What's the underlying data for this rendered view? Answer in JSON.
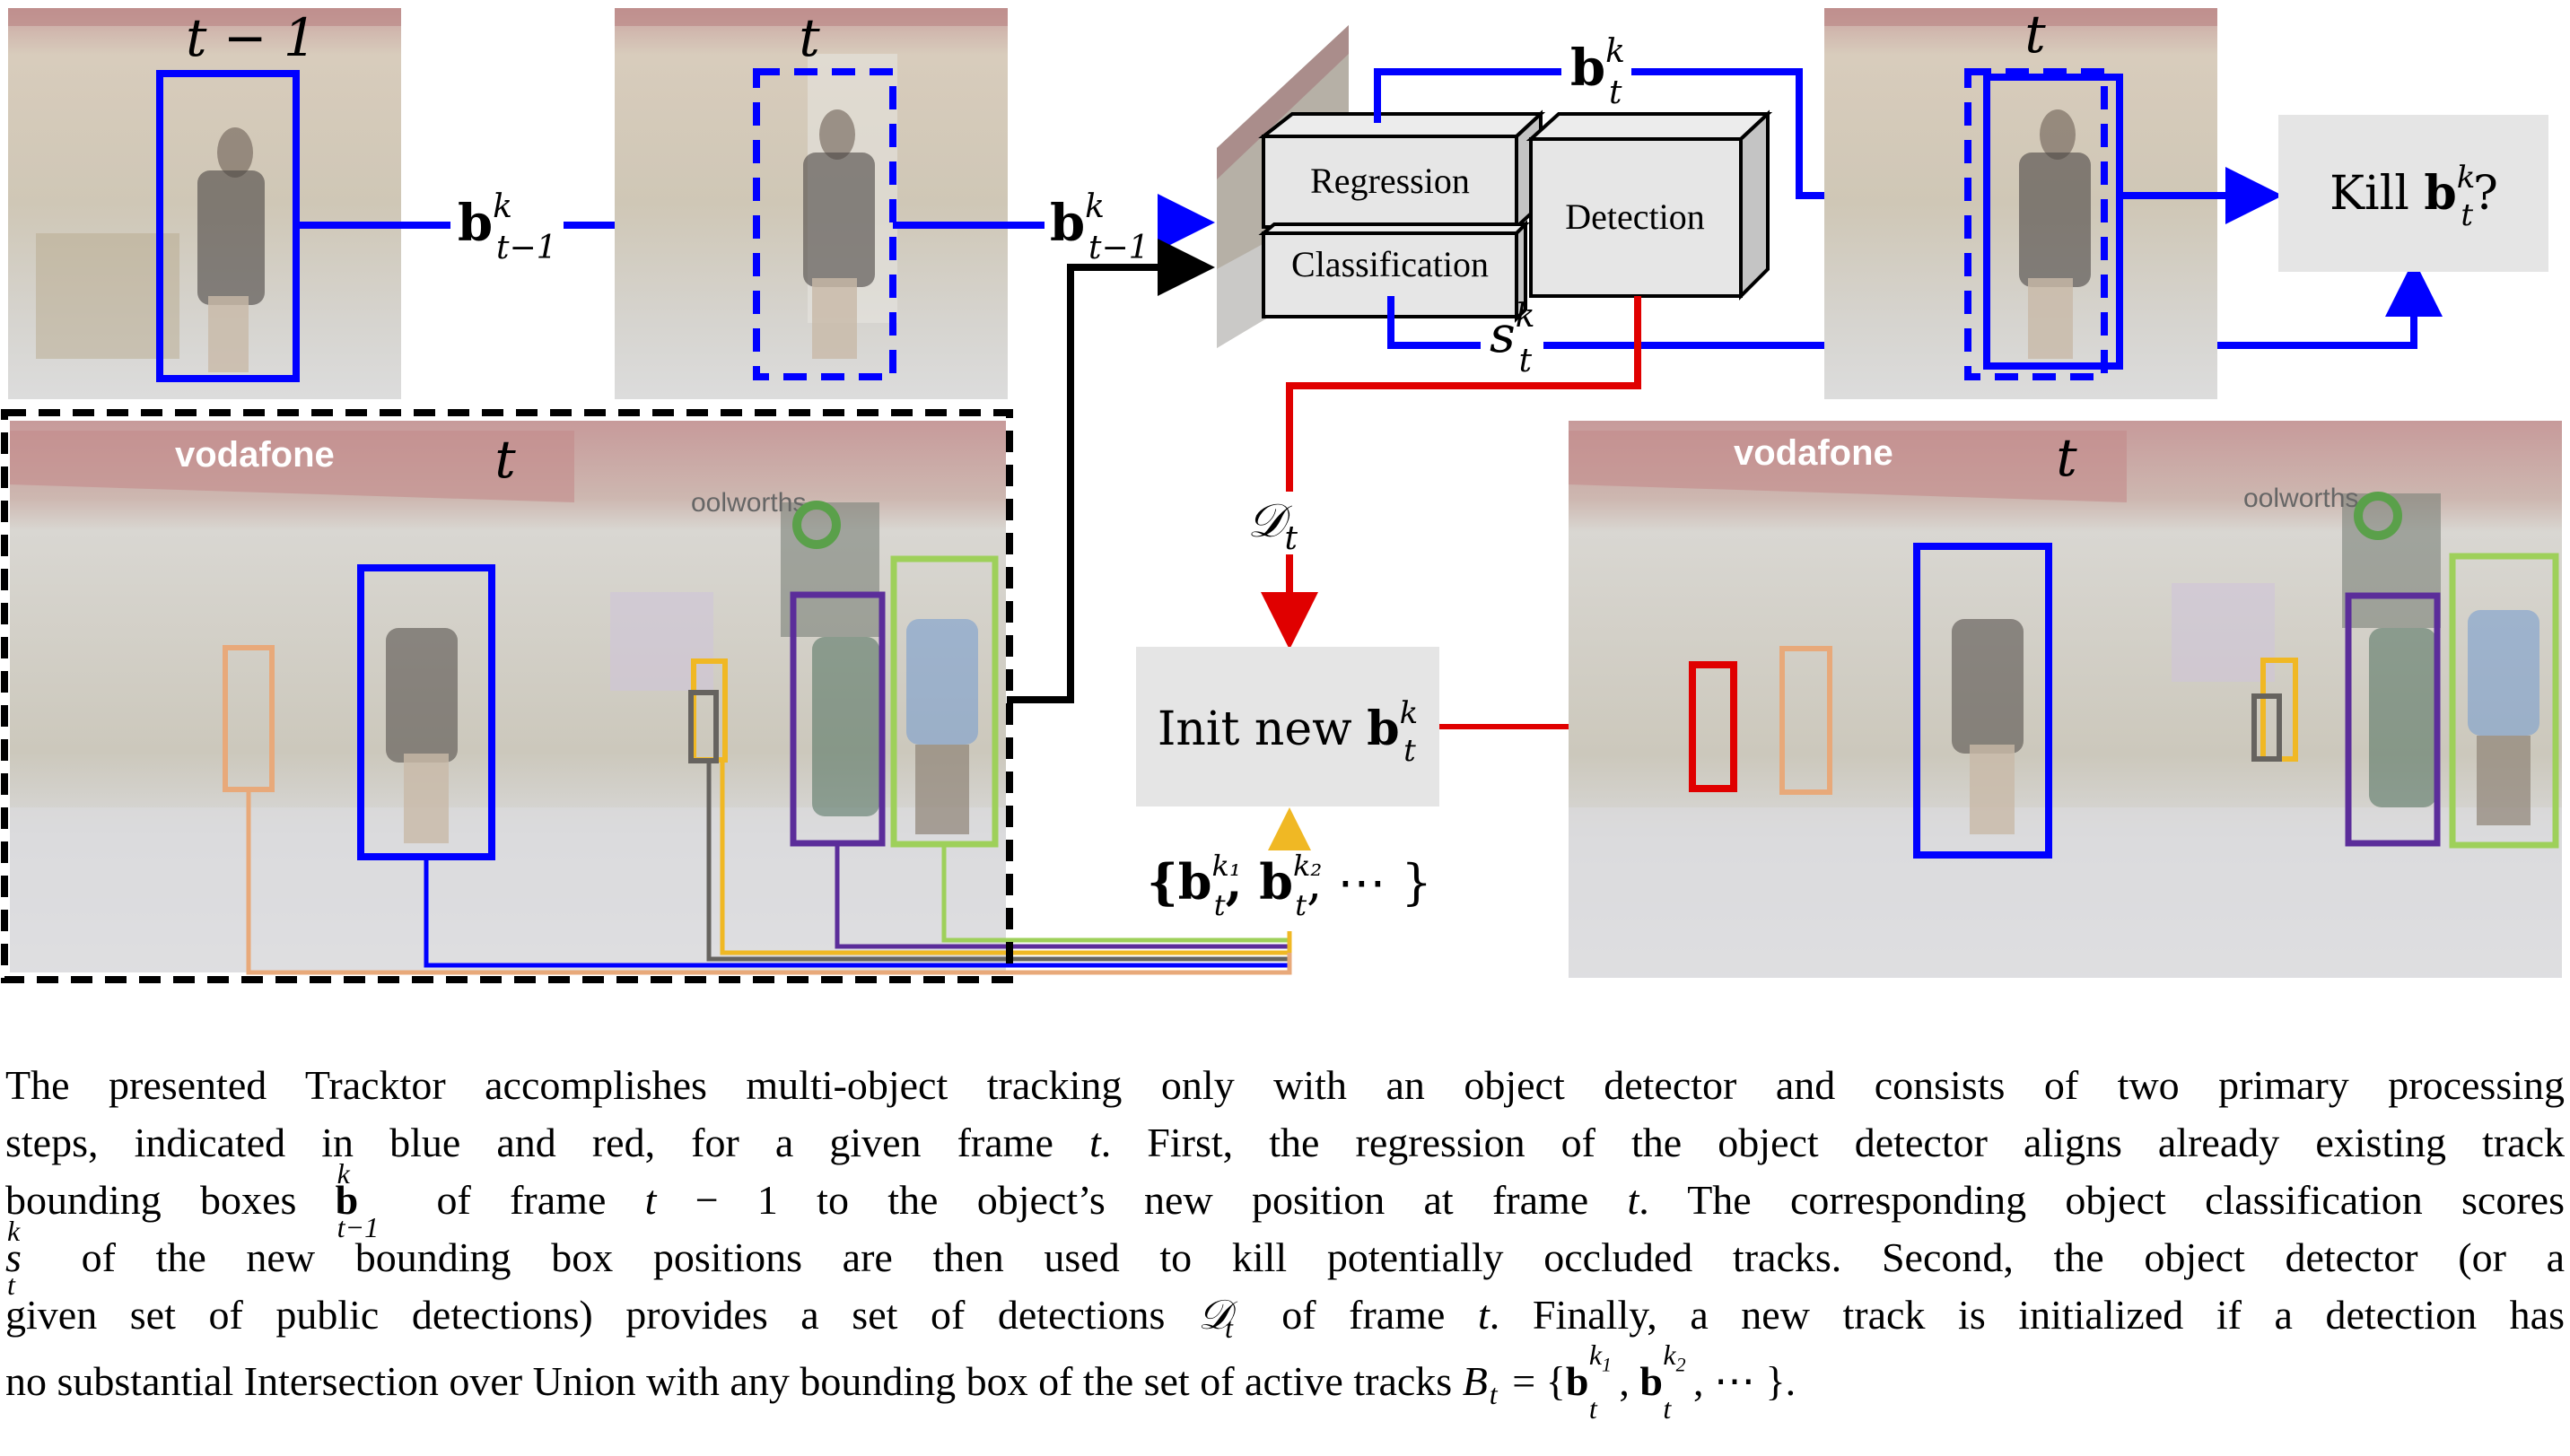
{
  "figure": {
    "frames": {
      "prev_frame_label": "t − 1",
      "curr_frame_label": "t",
      "regressed_frame_label": "t",
      "main_frame_label": "t",
      "output_frame_label": "t",
      "store_sign_left": "vodafone",
      "store_sign_right": "oolworths"
    },
    "edges": {
      "prev_box_label": "b",
      "prev_box_sup": "k",
      "prev_box_sub": "t−1",
      "input_box_label": "b",
      "input_box_sup": "k",
      "input_box_sub": "t−1",
      "regressed_box_label": "b",
      "regressed_box_sup": "k",
      "regressed_box_sub": "t",
      "score_label": "s",
      "score_sup": "k",
      "score_sub": "t",
      "detections_label": "𝒟",
      "detections_sub": "t",
      "active_set_label": "{b",
      "active_set_sup1": "k₁",
      "active_set_mid": ", b",
      "active_set_sup2": "k₂",
      "active_set_end": ", ⋯ }",
      "active_set_sub": "t"
    },
    "network": {
      "regression_label": "Regression",
      "classification_label": "Classification",
      "detection_label": "Detection"
    },
    "decisions": {
      "kill_label": "Kill ",
      "kill_b": "b",
      "kill_sup": "k",
      "kill_sub": "t",
      "kill_q": "?",
      "init_label": "Init new ",
      "init_b": "b",
      "init_sup": "k",
      "init_sub": "t"
    },
    "colors": {
      "regression_path": "#0000ff",
      "detection_path": "#e00000",
      "frame_input": "#000000",
      "track_blue": "#0000ff",
      "track_orange": "#e8a97a",
      "track_gray": "#66635f",
      "track_yellow": "#f0b824",
      "track_purple": "#5b2d9a",
      "track_green": "#9ed05a",
      "new_track_red": "#e00000",
      "box_fill": "#e5e5e5"
    }
  },
  "caption": {
    "l1": "The presented Tracktor accomplishes multi-object tracking only with an object detector and consists of two primary processing",
    "l2a": "steps, indicated in blue and red, for a given frame ",
    "l2t": "t",
    "l2b": ".  First, the regression of the object detector aligns already existing track",
    "l3a": "bounding boxes ",
    "l3b_bold": "b",
    "l3b_sup": "k",
    "l3b_sub": "t−1",
    "l3c": " of frame ",
    "l3t": "t",
    "l3d": " − 1 to the object’s new position at frame ",
    "l3t2": "t",
    "l3e": ".  The corresponding object classification scores",
    "l4s": "s",
    "l4s_sup": "k",
    "l4s_sub": "t",
    "l4a": " of the new bounding box positions are then used to kill potentially occluded tracks.  Second, the object detector (or a",
    "l5a": "given set of public detections) provides a set of detections ",
    "l5D": "𝒟",
    "l5D_sub": "t",
    "l5b": " of frame ",
    "l5t": "t",
    "l5c": ". Finally, a new track is initialized if a detection has",
    "l6a": "no substantial Intersection over Union with any bounding box of the set of active tracks ",
    "l6B": "B",
    "l6B_sub": "t",
    "l6eq": " = {",
    "l6b1": "b",
    "l6b1_sup": "k",
    "l6b1_supsub": "1",
    "l6comma": ", ",
    "l6b2": "b",
    "l6b2_sup": "k",
    "l6b2_supsub": "2",
    "l6end": ", ⋯ }."
  }
}
